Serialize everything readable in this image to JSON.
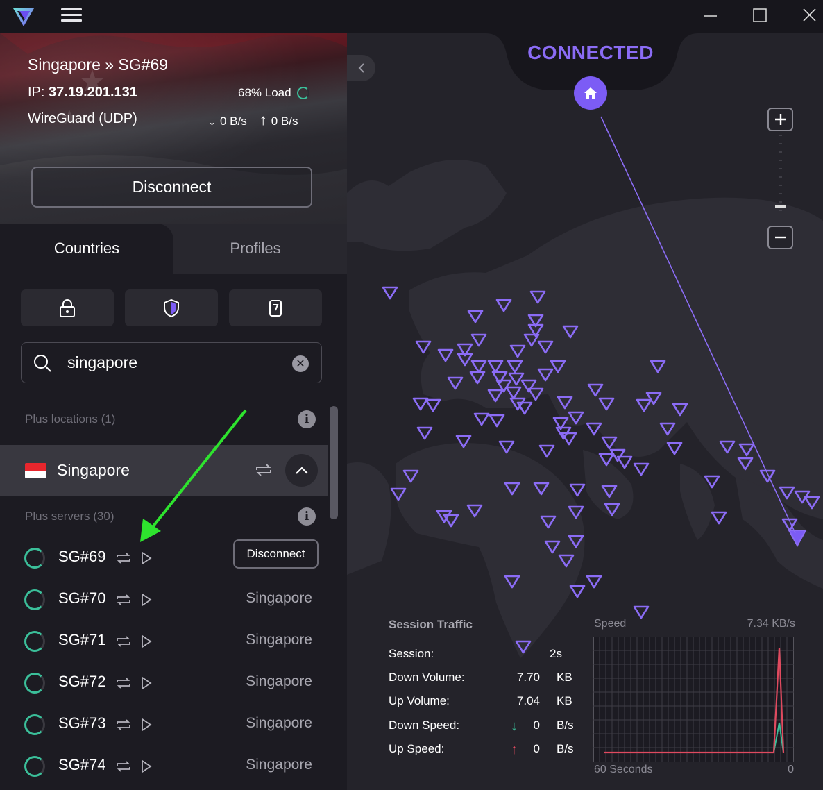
{
  "titlebar": {
    "minimize_label": "—",
    "maximize_label": "☐",
    "close_label": "✕"
  },
  "connection": {
    "location": "Singapore » SG#69",
    "ip_label": "IP:",
    "ip": "37.19.201.131",
    "load": "68% Load",
    "protocol": "WireGuard (UDP)",
    "down_rate": "0 B/s",
    "up_rate": "0 B/s",
    "disconnect_label": "Disconnect"
  },
  "tabs": {
    "countries": "Countries",
    "profiles": "Profiles"
  },
  "search": {
    "value": "singapore"
  },
  "sections": {
    "plus_locations": "Plus locations (1)",
    "plus_servers": "Plus servers (30)"
  },
  "country": {
    "name": "Singapore"
  },
  "servers": [
    {
      "name": "SG#69",
      "city": "",
      "action": "Disconnect"
    },
    {
      "name": "SG#70",
      "city": "Singapore"
    },
    {
      "name": "SG#71",
      "city": "Singapore"
    },
    {
      "name": "SG#72",
      "city": "Singapore"
    },
    {
      "name": "SG#73",
      "city": "Singapore"
    },
    {
      "name": "SG#74",
      "city": "Singapore"
    }
  ],
  "map": {
    "status": "CONNECTED",
    "accent": "#8b6cf5",
    "zoom_in": "+",
    "zoom_out": "−"
  },
  "session": {
    "title": "Session Traffic",
    "rows": [
      {
        "label": "Session:",
        "value": "2s",
        "unit": ""
      },
      {
        "label": "Down Volume:",
        "value": "7.70",
        "unit": "KB"
      },
      {
        "label": "Up Volume:",
        "value": "7.04",
        "unit": "KB"
      },
      {
        "label": "Down Speed:",
        "value": "0",
        "unit": "B/s",
        "arrow": "↓"
      },
      {
        "label": "Up Speed:",
        "value": "0",
        "unit": "B/s",
        "arrow": "↑"
      }
    ]
  },
  "speed_chart": {
    "label": "Speed",
    "max": "7.34  KB/s",
    "footer_left": "60 Seconds",
    "footer_right": "0"
  }
}
